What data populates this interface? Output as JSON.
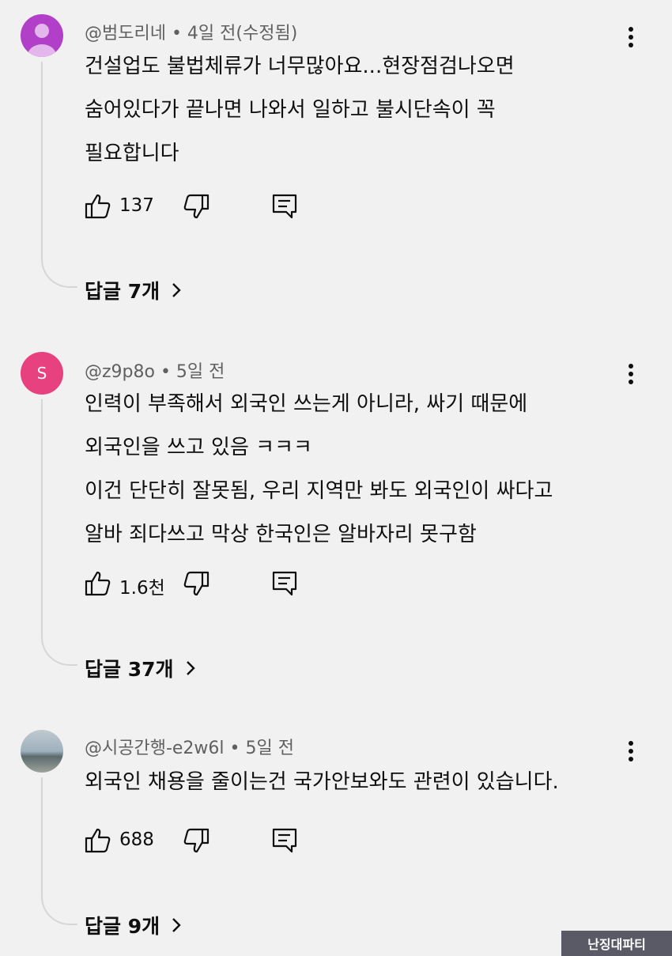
{
  "comments": [
    {
      "meta": "@범도리네 • 4일 전(수정됨)",
      "lines": [
        "건설업도 불법체류가 너무많아요...현장점검나오면",
        "숨어있다가 끝나면 나와서 일하고 불시단속이 꼭",
        "필요합니다"
      ],
      "likes": "137",
      "replies": "답글 7개",
      "avatar_color": "#b23fc8"
    },
    {
      "meta": "@z9p8o • 5일 전",
      "avatar_letter": "S",
      "lines": [
        "인력이 부족해서 외국인 쓰는게 아니라, 싸기 때문에",
        "외국인을 쓰고 있음 ㅋㅋㅋ",
        "이건 단단히 잘못됨, 우리 지역만 봐도 외국인이 싸다고",
        "알바 죄다쓰고 막상 한국인은 알바자리 못구함"
      ],
      "likes": "1.6천",
      "replies": "답글 37개",
      "avatar_color": "#e8417f"
    },
    {
      "meta": "@시공간행-e2w6l • 5일 전",
      "lines": [
        "외국인 채용을 줄이는건 국가안보와도 관련이 있습니다."
      ],
      "likes": "688",
      "replies": "답글 9개"
    }
  ],
  "watermark": "난징대파티",
  "icons": [
    "more-vert-icon",
    "thumb-up-icon",
    "thumb-down-icon",
    "reply-icon",
    "chevron-right-icon",
    "default-avatar-icon"
  ]
}
